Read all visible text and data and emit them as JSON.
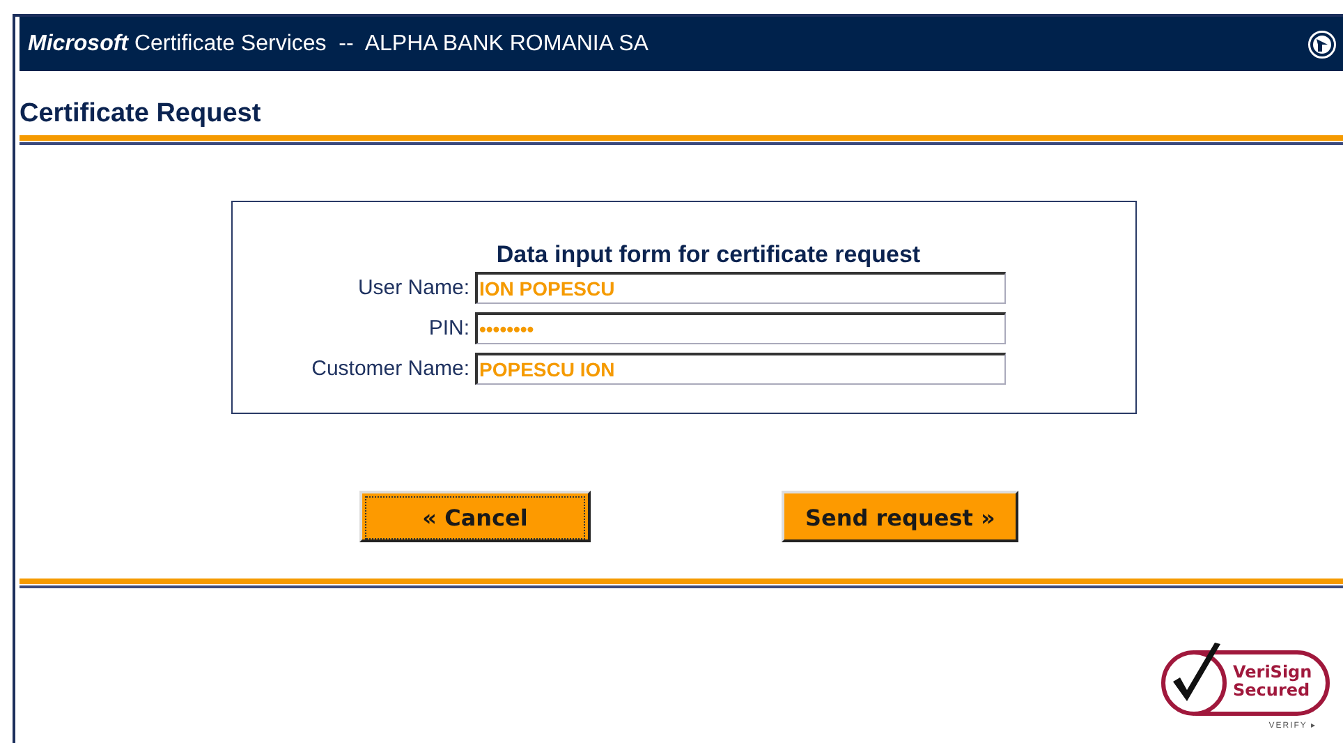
{
  "header": {
    "brand": "Microsoft",
    "title": "Certificate Services  --  ALPHA BANK ROMANIA SA"
  },
  "page_title": "Certificate Request",
  "form": {
    "heading": "Data input form for certificate request",
    "fields": [
      {
        "label": "User Name:",
        "value": "ION POPESCU"
      },
      {
        "label": "PIN:",
        "value": "••••••••"
      },
      {
        "label": "Customer Name:",
        "value": "POPESCU ION"
      }
    ]
  },
  "buttons": [
    {
      "label": "« Cancel",
      "focused": true
    },
    {
      "label": "Send request »",
      "focused": false
    }
  ],
  "badge": {
    "line_1": "VeriSign",
    "line_2": "Secured",
    "link": "VERIFY ▸"
  }
}
